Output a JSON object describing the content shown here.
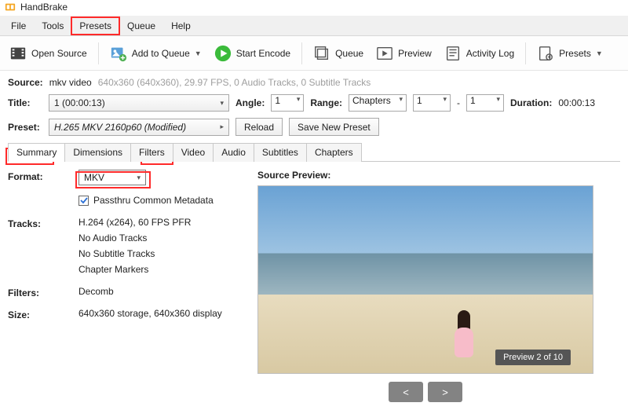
{
  "app": {
    "title": "HandBrake"
  },
  "menubar": {
    "file": "File",
    "tools": "Tools",
    "presets": "Presets",
    "queue": "Queue",
    "help": "Help"
  },
  "toolbar": {
    "open_source": "Open Source",
    "add_to_queue": "Add to Queue",
    "start_encode": "Start Encode",
    "queue": "Queue",
    "preview": "Preview",
    "activity_log": "Activity Log",
    "presets": "Presets"
  },
  "source": {
    "label": "Source:",
    "name": "mkv video",
    "details": "640x360 (640x360), 29.97 FPS, 0 Audio Tracks, 0 Subtitle Tracks"
  },
  "title_row": {
    "title_label": "Title:",
    "title_value": "1  (00:00:13)",
    "angle_label": "Angle:",
    "angle_value": "1",
    "range_label": "Range:",
    "range_type": "Chapters",
    "range_from": "1",
    "dash": "-",
    "range_to": "1",
    "duration_label": "Duration:",
    "duration_value": "00:00:13"
  },
  "preset_row": {
    "preset_label": "Preset:",
    "preset_value": "H.265 MKV 2160p60  (Modified)",
    "reload": "Reload",
    "save_new": "Save New Preset"
  },
  "tabs": {
    "summary": "Summary",
    "dimensions": "Dimensions",
    "filters": "Filters",
    "video": "Video",
    "audio": "Audio",
    "subtitles": "Subtitles",
    "chapters": "Chapters"
  },
  "summary": {
    "format_label": "Format:",
    "format_value": "MKV",
    "passthru": "Passthru Common Metadata",
    "tracks_label": "Tracks:",
    "tracks": {
      "video": "H.264 (x264), 60 FPS PFR",
      "audio": "No Audio Tracks",
      "subs": "No Subtitle Tracks",
      "chapters": "Chapter Markers"
    },
    "filters_label": "Filters:",
    "filters_value": "Decomb",
    "size_label": "Size:",
    "size_value": "640x360 storage, 640x360 display"
  },
  "preview": {
    "label": "Source Preview:",
    "tooltip": "Preview 2 of 10",
    "prev": "<",
    "next": ">"
  }
}
